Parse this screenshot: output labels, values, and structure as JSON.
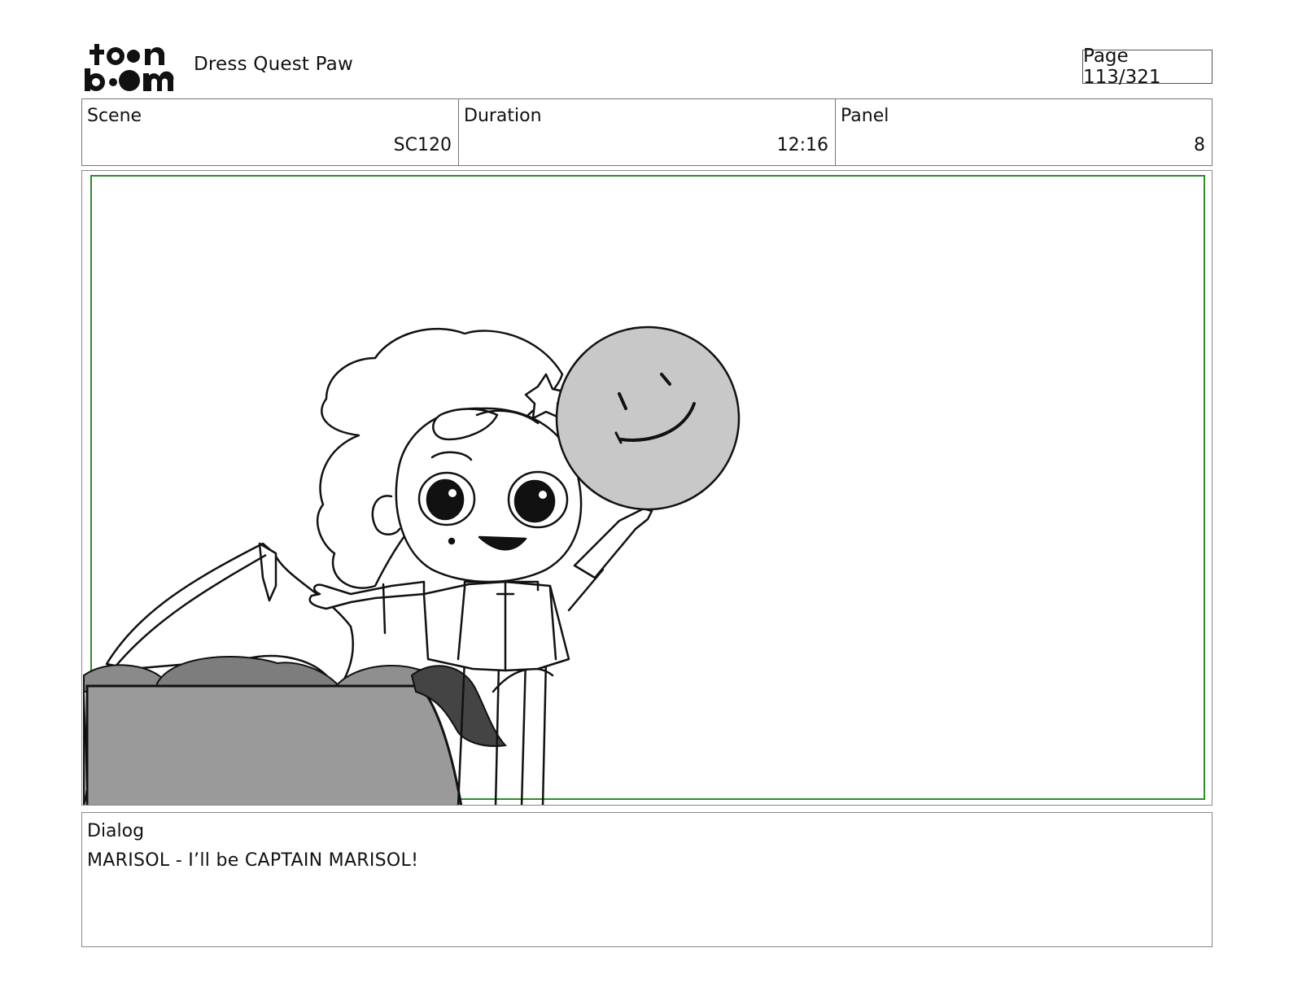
{
  "header": {
    "logo_text": "toon boom",
    "project_title": "Dress Quest Paw",
    "page_indicator": "Page 113/321"
  },
  "info": {
    "scene_label": "Scene",
    "scene_value": "SC120",
    "duration_label": "Duration",
    "duration_value": "12:16",
    "panel_label": "Panel",
    "panel_value": "8"
  },
  "dialog": {
    "label": "Dialog",
    "text": "MARISOL - I’ll be CAPTAIN MARISOL!"
  },
  "colors": {
    "safe_frame": "#2e8b2e",
    "fill_gray": "#9a9a9a",
    "fill_dark": "#777777",
    "balloon_gray": "#c8c8c8"
  }
}
